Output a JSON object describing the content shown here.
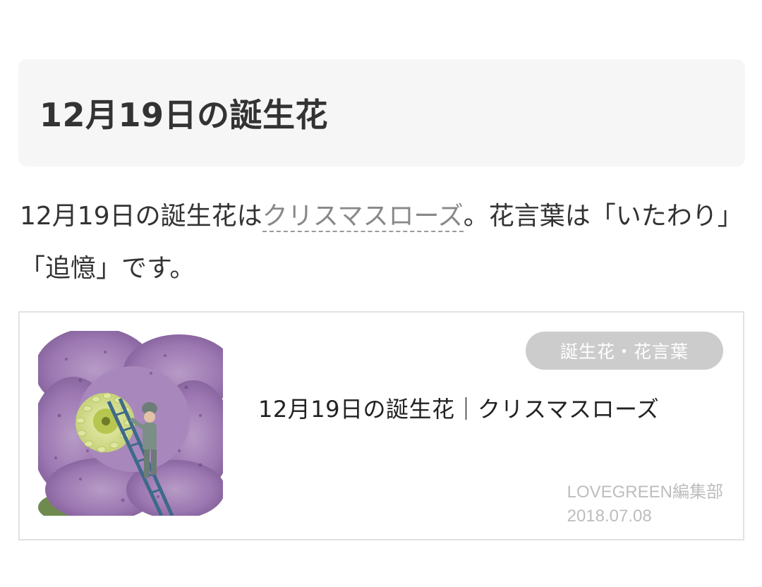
{
  "section": {
    "heading": "12月19日の誕生花"
  },
  "intro": {
    "before": "12月19日の誕生花は",
    "link": "クリスマスローズ",
    "after": "。花言葉は「いたわり」「追憶」です。"
  },
  "card": {
    "category": "誕生花・花言葉",
    "title": "12月19日の誕生花｜クリスマスローズ",
    "author": "LOVEGREEN編集部",
    "date": "2018.07.08",
    "thumbnail": "purple-christmas-rose-with-miniature-figure-on-ladder"
  }
}
